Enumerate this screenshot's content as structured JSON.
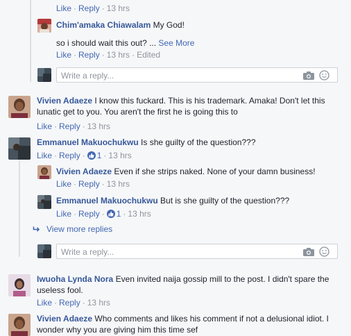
{
  "common": {
    "like": "Like",
    "reply": "Reply",
    "dot": "·",
    "reply_placeholder": "Write a reply...",
    "see_more": "See More"
  },
  "thread1": {
    "top_meta": {
      "time": "13 hrs"
    },
    "reply_chim": {
      "name": "Chim'amaka Chiawalam",
      "text1": "My God!",
      "text2": "so i should wait this out? ...",
      "time": "13 hrs",
      "edited": "Edited"
    }
  },
  "comment_vivien1": {
    "name": "Vivien Adaeze",
    "text": "I know this fuckard. This is his trademark. Amaka! Don't let this lunatic get to you. You aren't the first he is going this to",
    "time": "13 hrs"
  },
  "comment_emmanuel": {
    "name": "Emmanuel Makuochukwu",
    "text": "Is she guilty of the question???",
    "likes": "1",
    "time": "13 hrs",
    "replies": [
      {
        "name": "Vivien Adaeze",
        "text": "Even if she strips naked. None of your damn business!",
        "time": "13 hrs"
      },
      {
        "name": "Emmanuel Makuochukwu",
        "text": "But is she guilty of the question???",
        "likes": "1",
        "time": "13 hrs"
      }
    ],
    "view_more": "View more replies"
  },
  "comment_iwuoha": {
    "name": "Iwuoha Lynda Nora",
    "text": "Even invited naija gossip mill to the post. I didn't spare the useless fool.",
    "time": "13 hrs"
  },
  "comment_vivien2": {
    "name": "Vivien Adaeze",
    "text": "Who comments and likes his comment if not a delusional idiot. I wonder why you are giving him this time sef"
  },
  "colors": {
    "link": "#4267b2",
    "name": "#365899",
    "meta": "#90949c",
    "background": "#f6f7f9"
  }
}
